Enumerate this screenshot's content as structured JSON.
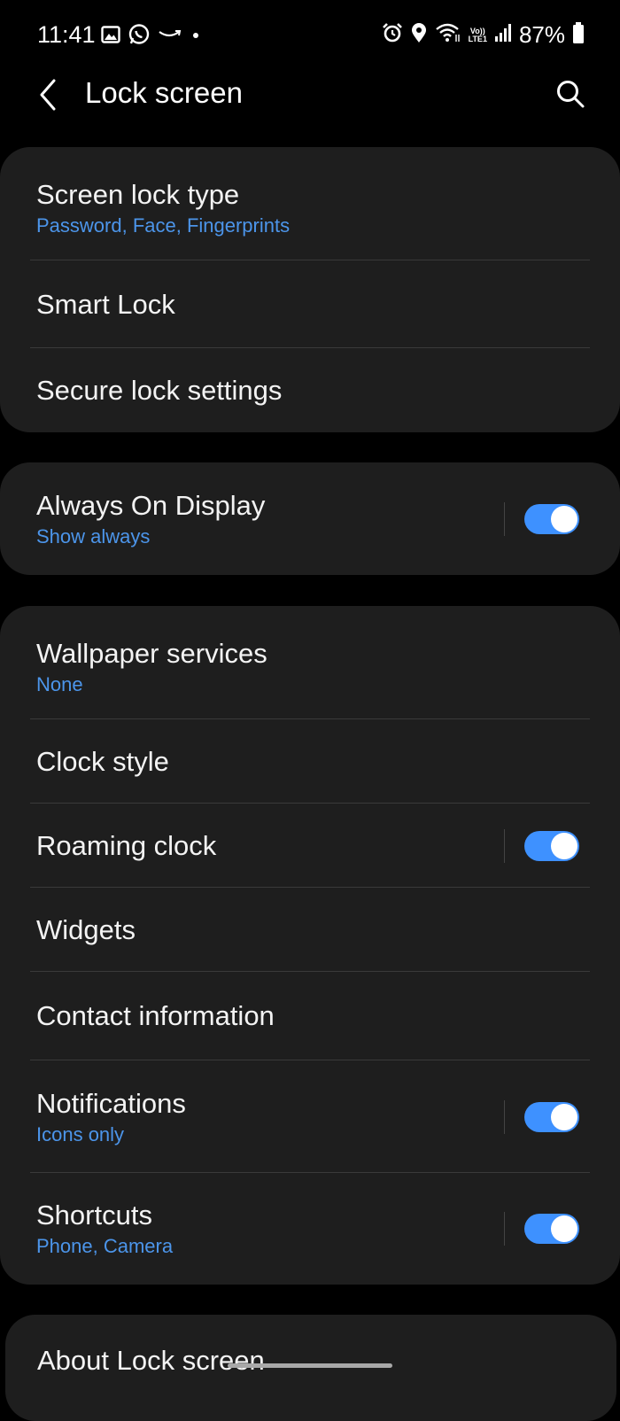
{
  "status_bar": {
    "time": "11:41",
    "left_icons": [
      "image-icon",
      "whatsapp-icon",
      "amazon-icon",
      "dot-icon"
    ],
    "right_icons": [
      "alarm-icon",
      "location-icon",
      "wifi-icon",
      "volte-icon",
      "signal-icon",
      "battery-icon"
    ],
    "volte_top": "Vo))",
    "volte_bottom": "LTE1",
    "battery": "87%"
  },
  "header": {
    "title": "Lock screen",
    "back_icon": "chevron-left-icon",
    "search_icon": "search-icon"
  },
  "sections": {
    "security": [
      {
        "title": "Screen lock type",
        "subtitle": "Password, Face, Fingerprints"
      },
      {
        "title": "Smart Lock"
      },
      {
        "title": "Secure lock settings"
      }
    ],
    "aod": {
      "title": "Always On Display",
      "subtitle": "Show always",
      "toggle_on": true
    },
    "customize": [
      {
        "title": "Wallpaper services",
        "subtitle": "None"
      },
      {
        "title": "Clock style"
      },
      {
        "title": "Roaming clock",
        "toggle_on": true
      },
      {
        "title": "Widgets"
      },
      {
        "title": "Contact information"
      },
      {
        "title": "Notifications",
        "subtitle": "Icons only",
        "toggle_on": true
      },
      {
        "title": "Shortcuts",
        "subtitle": "Phone, Camera",
        "toggle_on": true
      }
    ],
    "about": {
      "title": "About Lock screen"
    }
  },
  "colors": {
    "background": "#000000",
    "card": "#1e1e1e",
    "accent_text": "#4c95ea",
    "toggle_on": "#3e91ff"
  }
}
